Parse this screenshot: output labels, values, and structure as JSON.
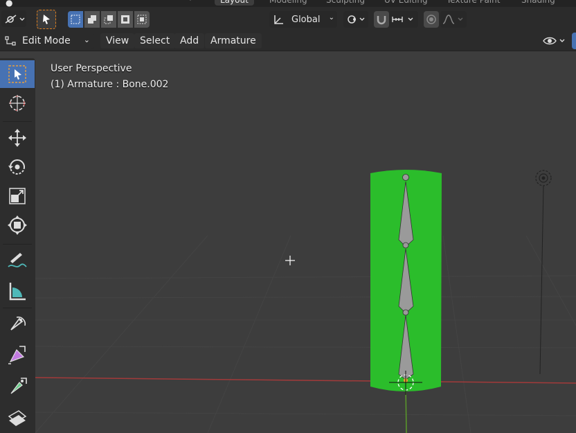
{
  "workspace_tabs": [
    "Layout",
    "Modeling",
    "Sculpting",
    "UV Editing",
    "Texture Paint",
    "Shading"
  ],
  "header": {
    "transform_orientation": "Global",
    "mode": "Edit Mode",
    "menus": [
      "View",
      "Select",
      "Add",
      "Armature"
    ]
  },
  "viewport": {
    "view_name": "User Perspective",
    "active_object": "(1) Armature : Bone.002"
  },
  "colors": {
    "accent": "#4772b3",
    "mesh_green": "#2bbd2b",
    "bone_grey": "#9a9a9a",
    "x_axis": "#a33a3a",
    "y_axis": "#5a9a2a",
    "origin": "#f0a030"
  },
  "icons": {
    "toolbar": [
      "select-box-icon",
      "cursor-icon",
      "move-icon",
      "rotate-icon",
      "scale-icon",
      "transform-icon",
      "annotate-icon",
      "measure-icon",
      "roll-icon",
      "bone-size-icon",
      "bone-envelope-icon",
      "extrude-icon"
    ]
  }
}
